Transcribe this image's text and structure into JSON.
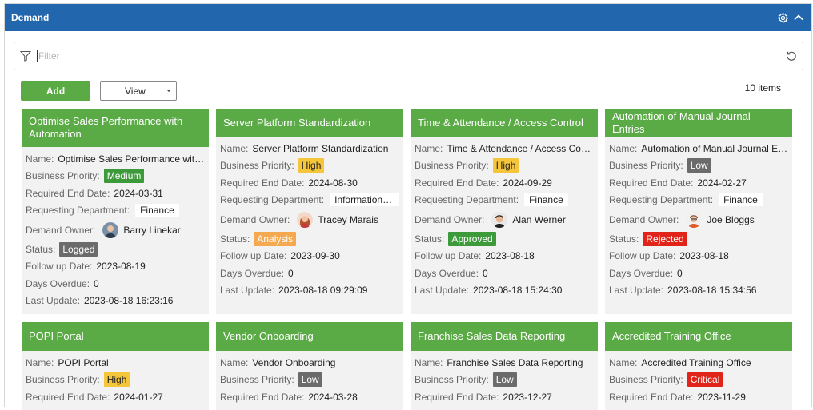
{
  "panel": {
    "title": "Demand"
  },
  "filter": {
    "placeholder": "Filter",
    "value": ""
  },
  "toolbar": {
    "add_label": "Add",
    "view_label": "View",
    "count_label": "10 items"
  },
  "labels": {
    "name": "Name:",
    "priority": "Business Priority:",
    "end_date": "Required End Date:",
    "dept": "Requesting Department:",
    "owner": "Demand Owner:",
    "status": "Status:",
    "follow": "Follow up Date:",
    "overdue": "Days Overdue:",
    "update": "Last Update:"
  },
  "colors": {
    "header_blue": "#2267ad",
    "card_green": "#5aaa45"
  },
  "cards": [
    {
      "title": "Optimise Sales Performance with Automation",
      "name": "Optimise Sales Performance with …",
      "priority": "Medium",
      "end_date": "2024-03-31",
      "dept": "Finance",
      "owner": "Barry Linekar",
      "status": "Logged",
      "follow": "2023-08-19",
      "overdue": "0",
      "update": "2023-08-18 16:23:16"
    },
    {
      "title": "Server Platform Standardization",
      "name": "Server Platform Standardization",
      "priority": "High",
      "end_date": "2024-08-30",
      "dept": "Information Techn",
      "owner": "Tracey Marais",
      "status": "Analysis",
      "follow": "2023-09-30",
      "overdue": "0",
      "update": "2023-08-18 09:29:09"
    },
    {
      "title": "Time & Attendance / Access Control",
      "name": "Time & Attendance / Access Contr…",
      "priority": "High",
      "end_date": "2024-09-29",
      "dept": "Finance",
      "owner": "Alan Werner",
      "status": "Approved",
      "follow": "2023-08-18",
      "overdue": "0",
      "update": "2023-08-18 15:24:30"
    },
    {
      "title": "Automation of Manual Journal Entries",
      "name": "Automation of Manual Journal Ent…",
      "priority": "Low",
      "end_date": "2024-02-27",
      "dept": "Finance",
      "owner": "Joe Bloggs",
      "status": "Rejected",
      "follow": "2023-08-18",
      "overdue": "0",
      "update": "2023-08-18 15:34:56"
    },
    {
      "title": "POPI Portal",
      "name": "POPI Portal",
      "priority": "High",
      "end_date": "2024-01-27"
    },
    {
      "title": "Vendor Onboarding",
      "name": "Vendor Onboarding",
      "priority": "Low",
      "end_date": "2024-03-28"
    },
    {
      "title": "Franchise Sales Data Reporting",
      "name": "Franchise Sales Data Reporting",
      "priority": "Low",
      "end_date": "2023-12-27"
    },
    {
      "title": "Accredited Training Office",
      "name": "Accredited Training Office",
      "priority": "Critical",
      "end_date": "2023-11-29"
    }
  ]
}
